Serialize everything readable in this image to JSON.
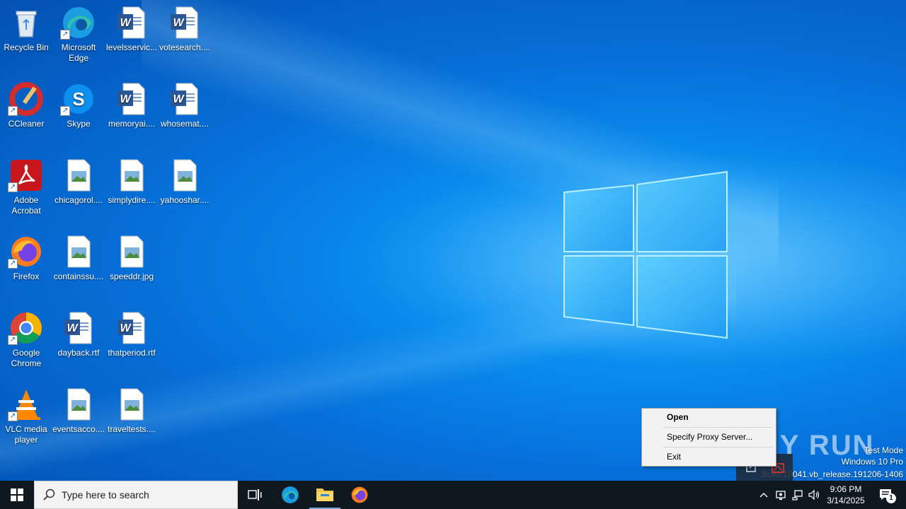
{
  "desktop": {
    "icons": [
      {
        "label": "Recycle Bin",
        "icon": "recycle-bin-icon"
      },
      {
        "label": "Microsoft Edge",
        "icon": "edge-icon"
      },
      {
        "label": "levelsservic...",
        "icon": "word-doc-icon"
      },
      {
        "label": "votesearch....",
        "icon": "word-doc-icon"
      },
      {
        "label": "CCleaner",
        "icon": "ccleaner-icon"
      },
      {
        "label": "Skype",
        "icon": "skype-icon"
      },
      {
        "label": "memoryai....",
        "icon": "word-doc-icon"
      },
      {
        "label": "whosemat....",
        "icon": "word-doc-icon"
      },
      {
        "label": "Adobe Acrobat",
        "icon": "acrobat-icon"
      },
      {
        "label": "chicagorol....",
        "icon": "image-file-icon"
      },
      {
        "label": "simplydire....",
        "icon": "image-file-icon"
      },
      {
        "label": "yahooshar....",
        "icon": "image-file-icon"
      },
      {
        "label": "Firefox",
        "icon": "firefox-icon"
      },
      {
        "label": "containssu....",
        "icon": "image-file-icon"
      },
      {
        "label": "speeddr.jpg",
        "icon": "image-file-icon"
      },
      {
        "label": "Google Chrome",
        "icon": "chrome-icon"
      },
      {
        "label": "dayback.rtf",
        "icon": "word-doc-icon"
      },
      {
        "label": "thatperiod.rtf",
        "icon": "word-doc-icon"
      },
      {
        "label": "VLC media player",
        "icon": "vlc-icon"
      },
      {
        "label": "eventsacco....",
        "icon": "image-file-icon"
      },
      {
        "label": "traveltests....",
        "icon": "image-file-icon"
      }
    ]
  },
  "context_menu": {
    "items": [
      "Open",
      "Specify Proxy Server...",
      "Exit"
    ]
  },
  "watermark": {
    "brand": "ANY RUN",
    "mode": "Test Mode",
    "edition": "Windows 10 Pro",
    "build": "Build 19041.vb_release.191206-1406"
  },
  "taskbar": {
    "search_placeholder": "Type here to search",
    "time": "9:06 PM",
    "date": "3/14/2025",
    "notification_count": "1"
  },
  "colors": {
    "taskbar_bg": "#101820",
    "desktop_accent": "#0a8ff0"
  }
}
